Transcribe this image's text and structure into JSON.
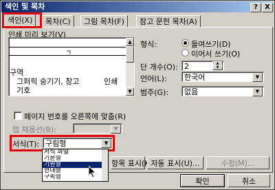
{
  "window": {
    "title": "색인 및 목차",
    "help_button": "?",
    "close_button": "X"
  },
  "tabs": [
    {
      "label": "색인(X)",
      "active": true
    },
    {
      "label": "목차(C)",
      "active": false
    },
    {
      "label": "그림 목차(F)",
      "active": false
    },
    {
      "label": "참고 문헌 목차(A)",
      "active": false
    }
  ],
  "print_preview": {
    "label": "인쇄 미리 보기(V)",
    "top_char": "ㄱ",
    "section_heading": "구역",
    "entry1": "그퍼픽 숭기기, 창고",
    "entry1_tail": "인쇄",
    "entry2": "기호"
  },
  "type": {
    "label": "형식:",
    "option_indented": "들여쓰기(D)",
    "option_runin": "이어서 쓰기(O)",
    "selected": "들여쓰기(D)"
  },
  "columns": {
    "label": "단 개수(O):",
    "value": "2"
  },
  "language": {
    "label": "언어(L):",
    "value": "한국어"
  },
  "category": {
    "label": "범주(G):",
    "value": "없음"
  },
  "right_align": {
    "label": "페이지 번호를 오른쪽에 맞춤(R)",
    "checked": false
  },
  "tab_leader": {
    "label": "탭 채움선(B):",
    "value": ""
  },
  "formats": {
    "label": "서식(T):",
    "value": "구림형",
    "options": [
      "서식 파일",
      "기본형",
      "기원형",
      "현대형",
      "구획형"
    ],
    "highlighted": "기원형"
  },
  "buttons": {
    "mark_entry": "항목 표시(K)...",
    "auto_mark": "자동 표시(U)...",
    "modify": "수정(M)...",
    "ok": "확인",
    "cancel": "취소"
  },
  "colors": {
    "highlight": "#e00000",
    "titlebar": "#0a246a",
    "selection": "#0a246a"
  }
}
